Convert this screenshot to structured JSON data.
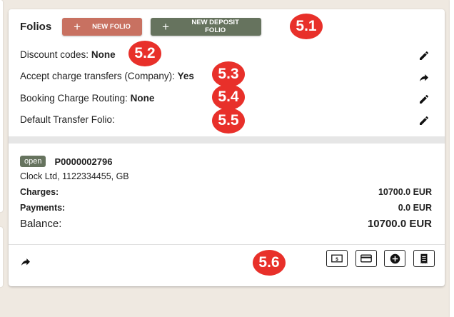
{
  "folios": {
    "title": "Folios",
    "new_folio_label": "NEW FOLIO",
    "new_deposit_folio_label": "NEW DEPOSIT FOLIO",
    "settings": {
      "discount": {
        "label": "Discount codes:",
        "value": "None"
      },
      "charge_transfers": {
        "label": "Accept charge transfers (Company):",
        "value": "Yes"
      },
      "routing": {
        "label": "Booking Charge Routing:",
        "value": "None"
      },
      "default_transfer": {
        "label": "Default Transfer Folio:",
        "value": ""
      }
    },
    "folio": {
      "status": "open",
      "number": "P0000002796",
      "company": "Clock Ltd, 1122334455, GB",
      "charges_label": "Charges:",
      "charges_value": "10700.0 EUR",
      "payments_label": "Payments:",
      "payments_value": "0.0 EUR",
      "balance_label": "Balance:",
      "balance_value": "10700.0 EUR"
    }
  },
  "annotations": [
    "5.1",
    "5.2",
    "5.3",
    "5.4",
    "5.5",
    "5.6"
  ],
  "colors": {
    "new_folio": "#c87161",
    "new_deposit_folio": "#66735e",
    "badge": "#e8302a",
    "status_open": "#66735e",
    "background": "#efe9e1"
  },
  "icons": {
    "edit": "pencil-icon",
    "transfer": "forward-arrow-icon",
    "cash": "cash-icon",
    "card": "credit-card-icon",
    "add": "plus-circle-icon",
    "invoice": "invoice-icon"
  }
}
